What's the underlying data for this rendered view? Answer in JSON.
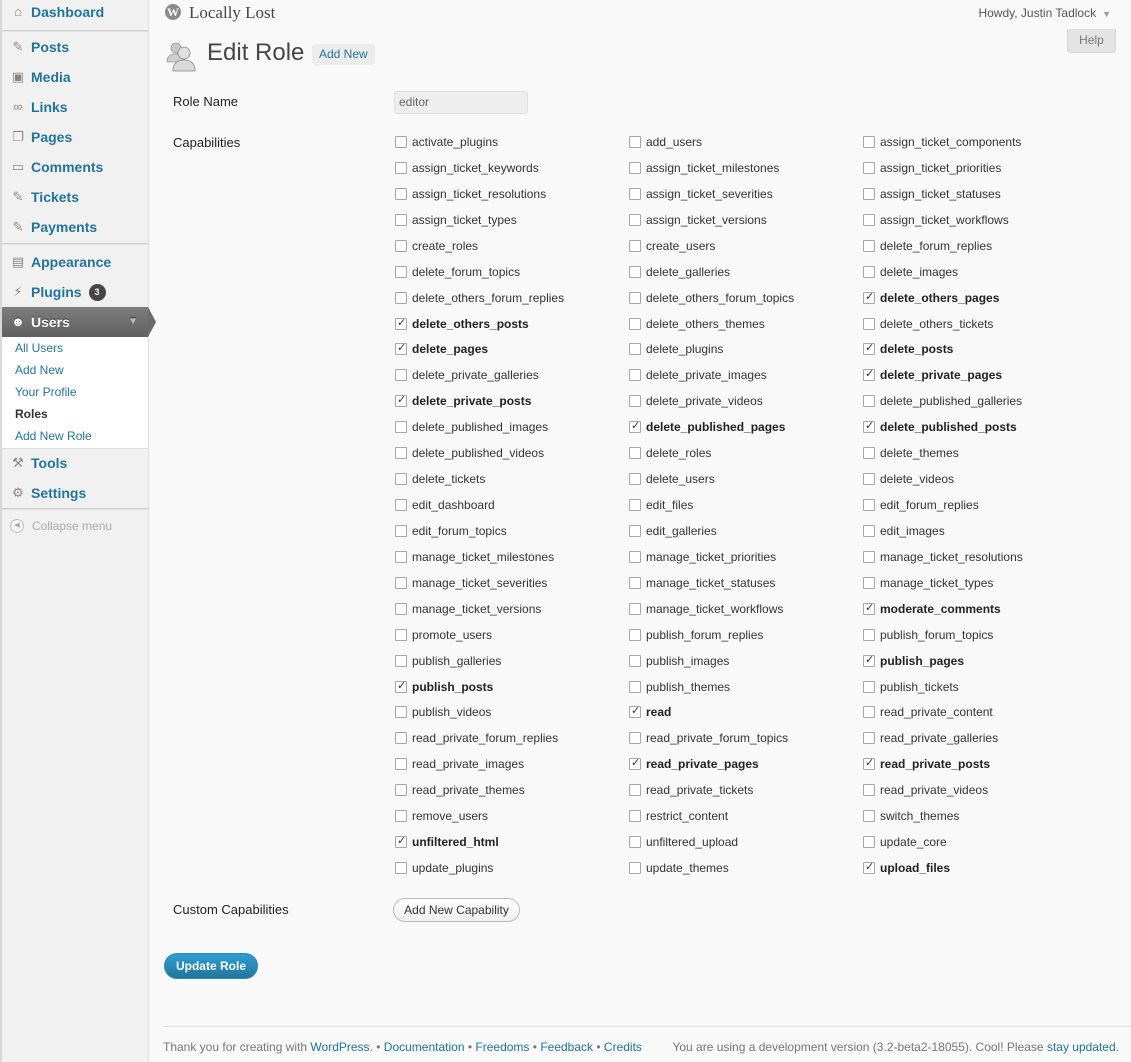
{
  "site": {
    "title": "Locally Lost",
    "howdy": "Howdy, Justin Tadlock",
    "dropdown_glyph": "▼",
    "help": "Help"
  },
  "sidebar": {
    "items": [
      {
        "label": "Dashboard",
        "icon": "dashboard-icon"
      },
      {
        "label": "Posts",
        "icon": "pin-icon"
      },
      {
        "label": "Media",
        "icon": "media-icon"
      },
      {
        "label": "Links",
        "icon": "link-icon"
      },
      {
        "label": "Pages",
        "icon": "pages-icon"
      },
      {
        "label": "Comments",
        "icon": "comment-icon"
      },
      {
        "label": "Tickets",
        "icon": "pin-icon"
      },
      {
        "label": "Payments",
        "icon": "pin-icon"
      },
      {
        "label": "Appearance",
        "icon": "appearance-icon"
      },
      {
        "label": "Plugins",
        "icon": "plugin-icon",
        "badge": "3"
      },
      {
        "label": "Users",
        "icon": "users-icon"
      },
      {
        "label": "Tools",
        "icon": "tools-icon"
      },
      {
        "label": "Settings",
        "icon": "settings-icon"
      }
    ],
    "users_submenu": [
      "All Users",
      "Add New",
      "Your Profile",
      "Roles",
      "Add New Role"
    ],
    "collapse": "Collapse menu"
  },
  "page": {
    "title": "Edit Role",
    "add_new": "Add New",
    "role_name_label": "Role Name",
    "role_name_value": "editor",
    "capabilities_label": "Capabilities",
    "custom_capabilities_label": "Custom Capabilities",
    "add_capability": "Add New Capability",
    "update_role": "Update Role"
  },
  "capabilities": [
    [
      "activate_plugins",
      false
    ],
    [
      "add_users",
      false
    ],
    [
      "assign_ticket_components",
      false
    ],
    [
      "assign_ticket_keywords",
      false
    ],
    [
      "assign_ticket_milestones",
      false
    ],
    [
      "assign_ticket_priorities",
      false
    ],
    [
      "assign_ticket_resolutions",
      false
    ],
    [
      "assign_ticket_severities",
      false
    ],
    [
      "assign_ticket_statuses",
      false
    ],
    [
      "assign_ticket_types",
      false
    ],
    [
      "assign_ticket_versions",
      false
    ],
    [
      "assign_ticket_workflows",
      false
    ],
    [
      "create_roles",
      false
    ],
    [
      "create_users",
      false
    ],
    [
      "delete_forum_replies",
      false
    ],
    [
      "delete_forum_topics",
      false
    ],
    [
      "delete_galleries",
      false
    ],
    [
      "delete_images",
      false
    ],
    [
      "delete_others_forum_replies",
      false
    ],
    [
      "delete_others_forum_topics",
      false
    ],
    [
      "delete_others_pages",
      true
    ],
    [
      "delete_others_posts",
      true
    ],
    [
      "delete_others_themes",
      false
    ],
    [
      "delete_others_tickets",
      false
    ],
    [
      "delete_pages",
      true
    ],
    [
      "delete_plugins",
      false
    ],
    [
      "delete_posts",
      true
    ],
    [
      "delete_private_galleries",
      false
    ],
    [
      "delete_private_images",
      false
    ],
    [
      "delete_private_pages",
      true
    ],
    [
      "delete_private_posts",
      true
    ],
    [
      "delete_private_videos",
      false
    ],
    [
      "delete_published_galleries",
      false
    ],
    [
      "delete_published_images",
      false
    ],
    [
      "delete_published_pages",
      true
    ],
    [
      "delete_published_posts",
      true
    ],
    [
      "delete_published_videos",
      false
    ],
    [
      "delete_roles",
      false
    ],
    [
      "delete_themes",
      false
    ],
    [
      "delete_tickets",
      false
    ],
    [
      "delete_users",
      false
    ],
    [
      "delete_videos",
      false
    ],
    [
      "edit_dashboard",
      false
    ],
    [
      "edit_files",
      false
    ],
    [
      "edit_forum_replies",
      false
    ],
    [
      "edit_forum_topics",
      false
    ],
    [
      "edit_galleries",
      false
    ],
    [
      "edit_images",
      false
    ],
    [
      "manage_ticket_milestones",
      false
    ],
    [
      "manage_ticket_priorities",
      false
    ],
    [
      "manage_ticket_resolutions",
      false
    ],
    [
      "manage_ticket_severities",
      false
    ],
    [
      "manage_ticket_statuses",
      false
    ],
    [
      "manage_ticket_types",
      false
    ],
    [
      "manage_ticket_versions",
      false
    ],
    [
      "manage_ticket_workflows",
      false
    ],
    [
      "moderate_comments",
      true
    ],
    [
      "promote_users",
      false
    ],
    [
      "publish_forum_replies",
      false
    ],
    [
      "publish_forum_topics",
      false
    ],
    [
      "publish_galleries",
      false
    ],
    [
      "publish_images",
      false
    ],
    [
      "publish_pages",
      true
    ],
    [
      "publish_posts",
      true
    ],
    [
      "publish_themes",
      false
    ],
    [
      "publish_tickets",
      false
    ],
    [
      "publish_videos",
      false
    ],
    [
      "read",
      true
    ],
    [
      "read_private_content",
      false
    ],
    [
      "read_private_forum_replies",
      false
    ],
    [
      "read_private_forum_topics",
      false
    ],
    [
      "read_private_galleries",
      false
    ],
    [
      "read_private_images",
      false
    ],
    [
      "read_private_pages",
      true
    ],
    [
      "read_private_posts",
      true
    ],
    [
      "read_private_themes",
      false
    ],
    [
      "read_private_tickets",
      false
    ],
    [
      "read_private_videos",
      false
    ],
    [
      "remove_users",
      false
    ],
    [
      "restrict_content",
      false
    ],
    [
      "switch_themes",
      false
    ],
    [
      "unfiltered_html",
      true
    ],
    [
      "unfiltered_upload",
      false
    ],
    [
      "update_core",
      false
    ],
    [
      "update_plugins",
      false
    ],
    [
      "update_themes",
      false
    ],
    [
      "upload_files",
      true
    ]
  ],
  "footer": {
    "thanks": "Thank you for creating with",
    "wordpress": "WordPress",
    "dot": ".",
    "sep": "•",
    "documentation": "Documentation",
    "freedoms": "Freedoms",
    "feedback": "Feedback",
    "credits": "Credits",
    "version_text": "You are using a development version (3.2-beta2-18055). Cool! Please",
    "stay_updated": "stay updated",
    "period": "."
  }
}
